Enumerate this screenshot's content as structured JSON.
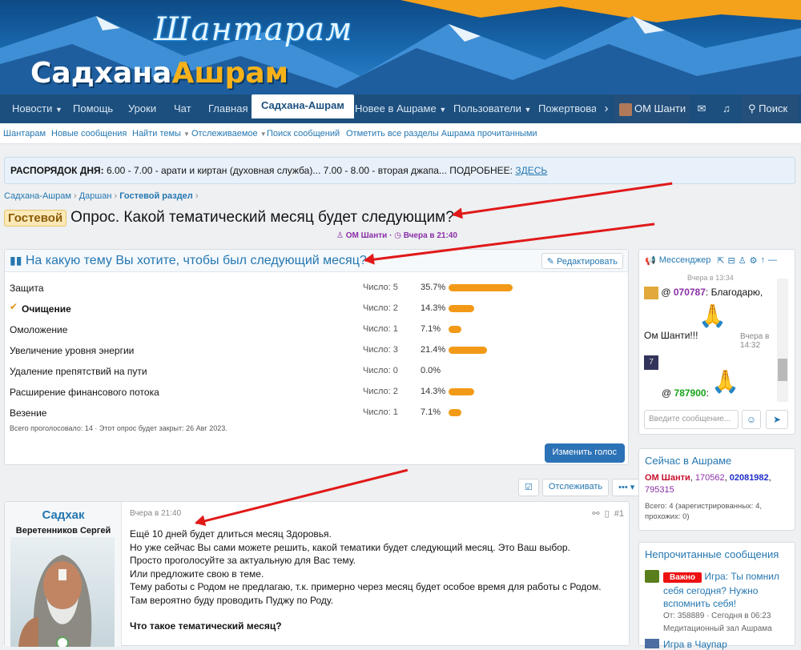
{
  "header": {
    "logo_script": "Шантарам",
    "logo_main_a": "Садхана",
    "logo_main_b": "Ашрам"
  },
  "nav": {
    "items": [
      "Новости",
      "Помощь",
      "Уроки",
      "Чат",
      "Главная",
      "Садхана-Ашрам",
      "Новее в Ашраме",
      "Пользователи",
      "Пожертвова"
    ],
    "user": "ОМ Шанти",
    "search": "Поиск"
  },
  "subnav": [
    "Шантарам",
    "Новые сообщения",
    "Найти темы",
    "Отслеживаемое",
    "Поиск сообщений",
    "Отметить все разделы Ашрама прочитанными"
  ],
  "notice": {
    "label": "РАСПОРЯДОК ДНЯ:",
    "text": " 6.00 - 7.00 - арати и киртан (духовная служба)... 7.00 - 8.00 - вторая джапа... ПОДРОБНЕЕ: ",
    "link": "ЗДЕСЬ"
  },
  "breadcrumbs": [
    "Садхана-Ашрам",
    "Даршан",
    "Гостевой раздел"
  ],
  "thread": {
    "prefix": "Гостевой",
    "title": "Опрос. Какой тематический месяц будет следующим?",
    "author": "ОМ Шанти",
    "time": "Вчера в 21:40"
  },
  "poll": {
    "question": "На какую тему Вы хотите, чтобы был следующий месяц?",
    "edit_label": "Редактировать",
    "count_label": "Число:",
    "options": [
      {
        "name": "Защита",
        "count": "5",
        "pct": "35.7%",
        "fraction": 0.357
      },
      {
        "name": "Очищение",
        "count": "2",
        "pct": "14.3%",
        "fraction": 0.143
      },
      {
        "name": "Омоложение",
        "count": "1",
        "pct": "7.1%",
        "fraction": 0.071
      },
      {
        "name": "Увеличение уровня энергии",
        "count": "3",
        "pct": "21.4%",
        "fraction": 0.214
      },
      {
        "name": "Удаление препятствий на пути",
        "count": "0",
        "pct": "0.0%",
        "fraction": 0
      },
      {
        "name": "Расширение финансового потока",
        "count": "2",
        "pct": "14.3%",
        "fraction": 0.143
      },
      {
        "name": "Везение",
        "count": "1",
        "pct": "7.1%",
        "fraction": 0.071
      }
    ],
    "total": "Всего проголосовало: 14 · Этот опрос будет закрыт: 26 Авг 2023.",
    "change_vote": "Изменить голос"
  },
  "follow": {
    "watch_label": "Отслеживать"
  },
  "post": {
    "author": "Садхак",
    "user_title": "Веретенников Сергей",
    "date": "Вчера в 21:40",
    "number": "#1",
    "lines": [
      "Ещё 10 дней будет длиться месяц Здоровья.",
      "Но уже сейчас Вы сами можете решить, какой тематики будет следующий месяц. Это Ваш выбор.",
      "Просто проголосуйте за актуальную для Вас тему.",
      "Или предложите свою в теме.",
      "Тему работы с Родом не предлагаю, т.к. примерно через месяц будет особое время для работы с Родом. Там вероятно буду проводить Пуджу по Роду."
    ],
    "subheading": "Что такое тематический месяц?"
  },
  "chat": {
    "title": "Мессенджер",
    "top_time": "Вчера в 13:34",
    "msg1_user": "070787",
    "msg1_text": ": Благодарю,",
    "msg1_text2": "Ом Шанти!!!",
    "msg1_time": "Вчера в 14:32",
    "msg2_user": "787900",
    "input_placeholder": "Введите сообщение...",
    "avatar_digit": "7"
  },
  "online": {
    "title": "Сейчас в Ашраме",
    "user1": "ОМ Шанти",
    "user2": "170562",
    "user3": "02081982",
    "user4": "795315",
    "stats": "Всего: 4 (зарегистрированных: 4, прохожих: 0)"
  },
  "unread": {
    "title": "Непрочитанные сообщения",
    "badge": "Важно",
    "item1_title": "Игра: Ты помнил себя сегодня? Нужно вспомнить себя!",
    "item1_meta": "От: 358889 · Сегодня в 06:23",
    "item1_forum": "Медитационный зал Ашрама",
    "item2_title": "Игра в Чаупар"
  },
  "colors": {
    "accent": "#2577b1",
    "nav": "#1c4f7e",
    "bar": "#f29a17",
    "arrow": "#e11919",
    "online_user1": "#c8102e",
    "online_user2": "#8a2ea6",
    "online_user3": "#1e2ec7"
  }
}
